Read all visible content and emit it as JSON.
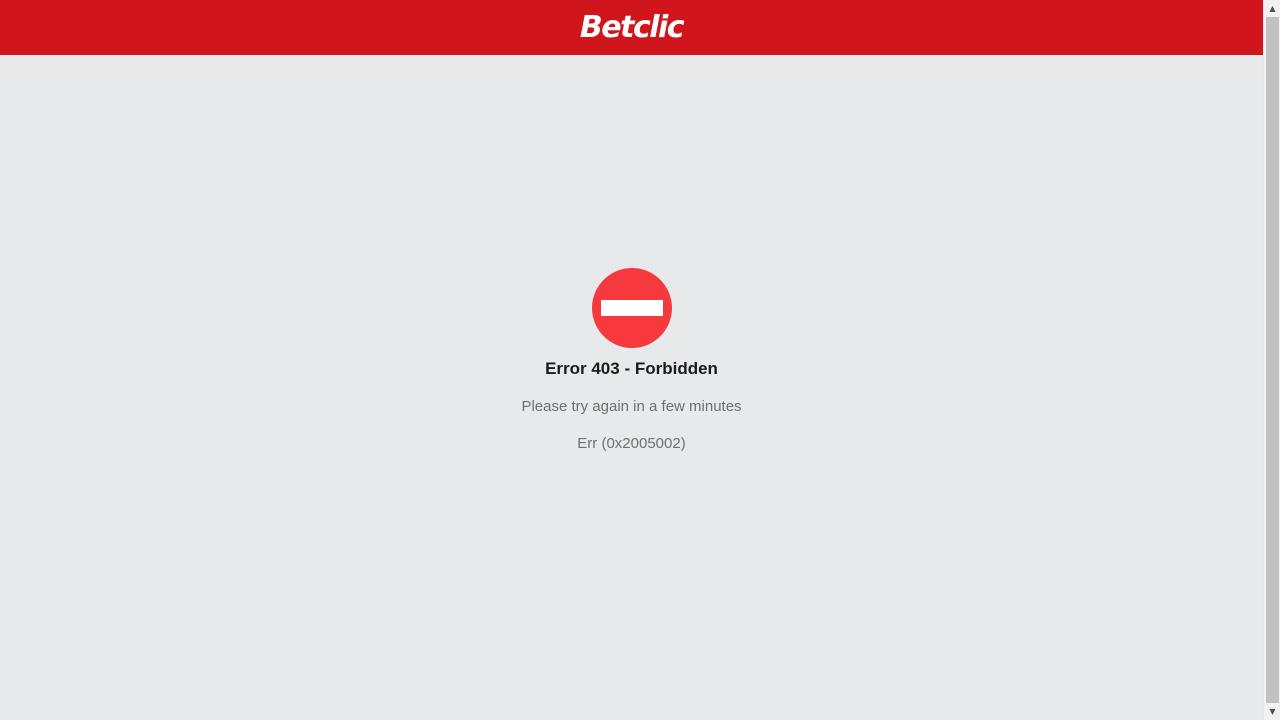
{
  "header": {
    "brand": "Betclic",
    "background": "#d0151c"
  },
  "error": {
    "icon": "no-entry-icon",
    "icon_color": "#f5393d",
    "title": "Error 403 - Forbidden",
    "message": "Please try again in a few minutes",
    "code": "Err (0x2005002)"
  },
  "scrollbar": {
    "up_arrow": "▲",
    "down_arrow": "▼"
  }
}
